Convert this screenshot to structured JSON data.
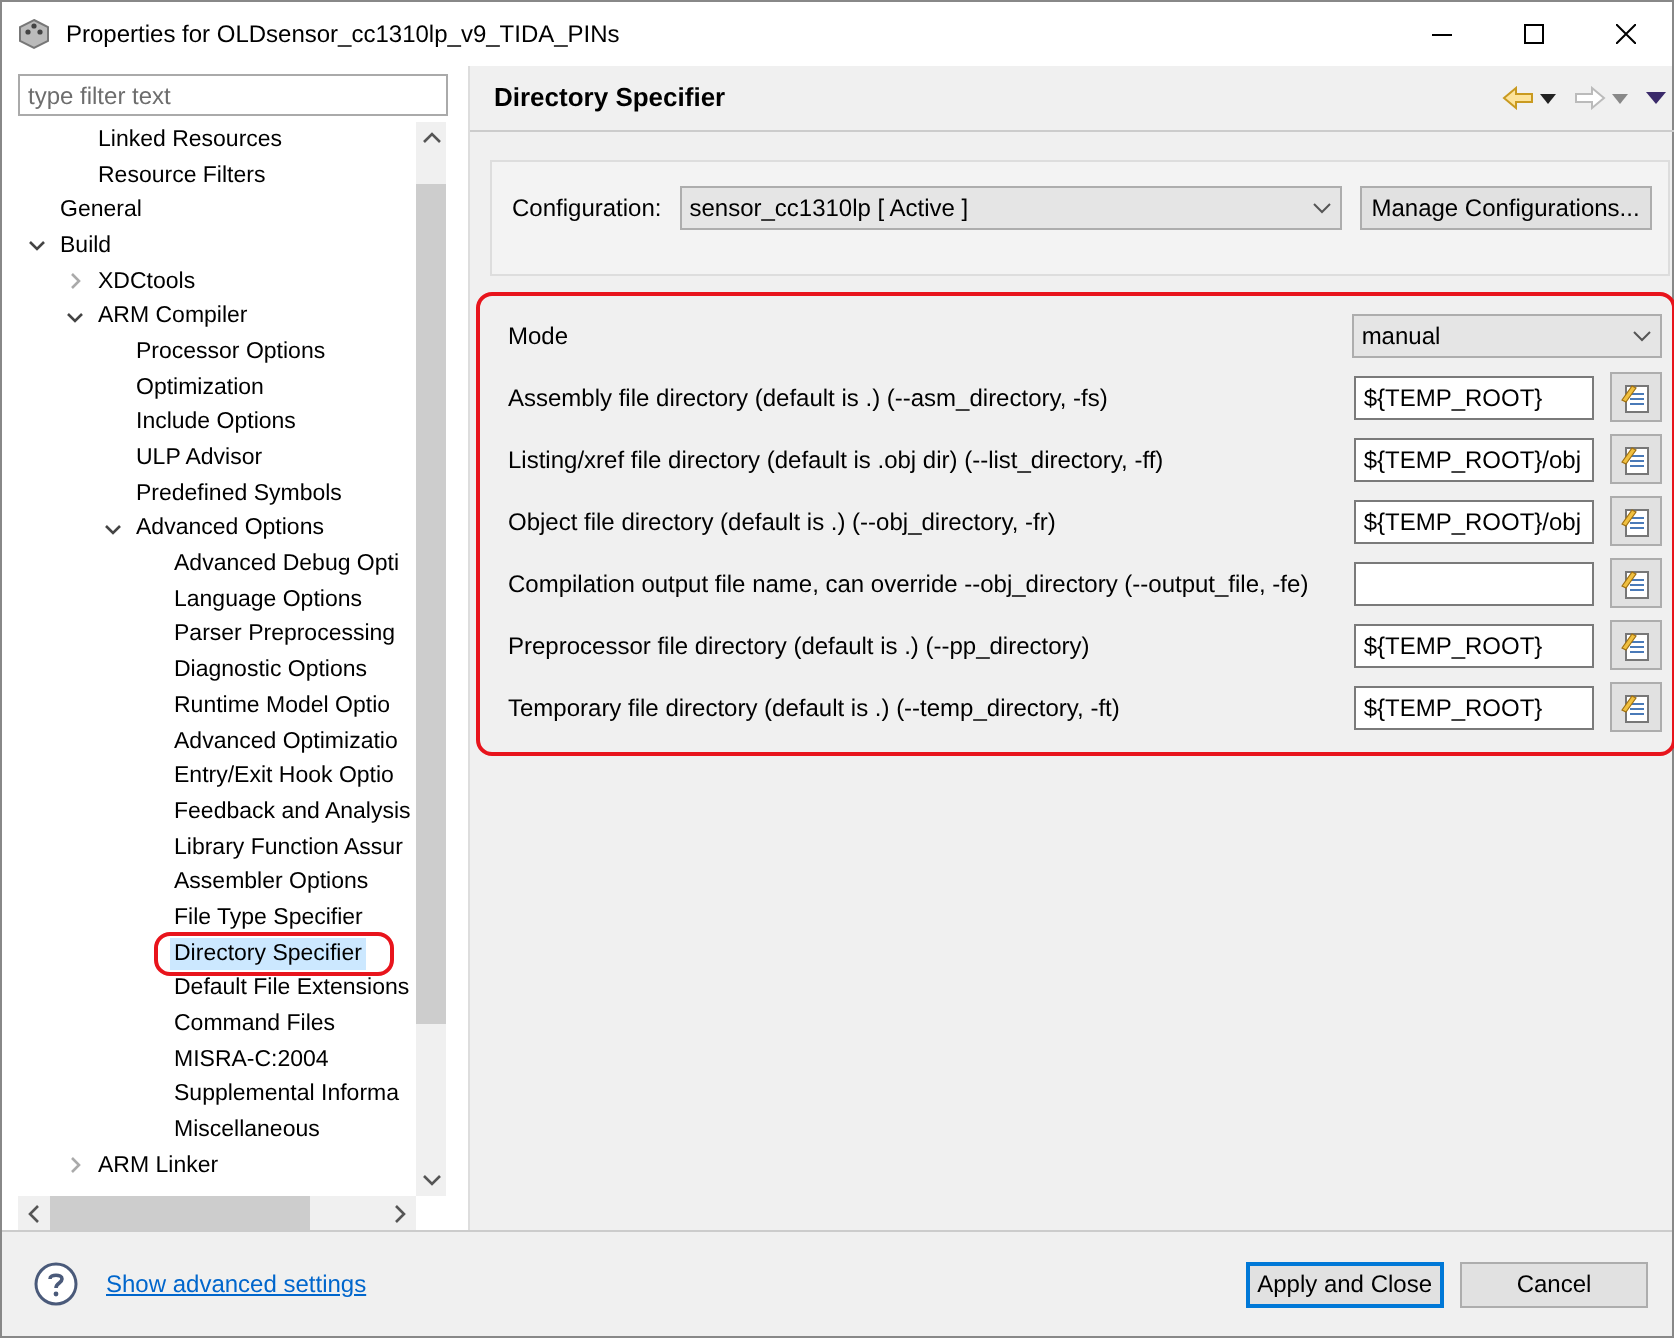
{
  "window": {
    "title": "Properties for OLDsensor_cc1310lp_v9_TIDA_PINs"
  },
  "filter": {
    "placeholder": "type filter text"
  },
  "tree": [
    {
      "children": [
        {
          "label": "Linked Resources",
          "selected": false
        },
        {
          "label": "Resource Filters",
          "selected": false
        }
      ]
    },
    {
      "label": "General",
      "selected": false
    },
    {
      "label": "Build",
      "selected": false,
      "expanded": true,
      "children": [
        {
          "label": "XDCtools",
          "selected": false,
          "expanded": false
        },
        {
          "label": "ARM Compiler",
          "selected": false,
          "expanded": true,
          "children": [
            {
              "label": "Processor Options",
              "selected": false
            },
            {
              "label": "Optimization",
              "selected": false
            },
            {
              "label": "Include Options",
              "selected": false
            },
            {
              "label": "ULP Advisor",
              "selected": false
            },
            {
              "label": "Predefined Symbols",
              "selected": false
            },
            {
              "label": "Advanced Options",
              "selected": false,
              "expanded": true,
              "children": [
                {
                  "label": "Advanced Debug Opti",
                  "selected": false
                },
                {
                  "label": "Language Options",
                  "selected": false
                },
                {
                  "label": "Parser Preprocessing",
                  "selected": false
                },
                {
                  "label": "Diagnostic Options",
                  "selected": false
                },
                {
                  "label": "Runtime Model Optio",
                  "selected": false
                },
                {
                  "label": "Advanced Optimizatio",
                  "selected": false
                },
                {
                  "label": "Entry/Exit Hook Optio",
                  "selected": false
                },
                {
                  "label": "Feedback and Analysis",
                  "selected": false
                },
                {
                  "label": "Library Function Assur",
                  "selected": false
                },
                {
                  "label": "Assembler Options",
                  "selected": false
                },
                {
                  "label": "File Type Specifier",
                  "selected": false
                },
                {
                  "label": "Directory Specifier",
                  "selected": true,
                  "annotated": true
                },
                {
                  "label": "Default File Extensions",
                  "selected": false
                },
                {
                  "label": "Command Files",
                  "selected": false
                },
                {
                  "label": "MISRA-C:2004",
                  "selected": false
                },
                {
                  "label": "Supplemental Informa",
                  "selected": false
                },
                {
                  "label": "Miscellaneous",
                  "selected": false
                }
              ]
            }
          ]
        },
        {
          "label": "ARM Linker",
          "selected": false,
          "expanded": false
        }
      ]
    }
  ],
  "page": {
    "title": "Directory Specifier"
  },
  "configuration": {
    "label": "Configuration:",
    "value": "sensor_cc1310lp  [ Active ]",
    "button": "Manage Configurations..."
  },
  "settings": {
    "annotated": true,
    "rows": [
      {
        "kind": "select",
        "label": "Mode",
        "value": "manual"
      },
      {
        "kind": "path",
        "label": "Assembly file directory (default is .) (--asm_directory, -fs)",
        "value": "${TEMP_ROOT}"
      },
      {
        "kind": "path",
        "label": "Listing/xref file directory (default is .obj dir) (--list_directory, -ff)",
        "value": "${TEMP_ROOT}/obj"
      },
      {
        "kind": "path",
        "label": "Object file directory (default is .) (--obj_directory, -fr)",
        "value": "${TEMP_ROOT}/obj"
      },
      {
        "kind": "path",
        "label": "Compilation output file name, can override --obj_directory (--output_file, -fe)"
      },
      {
        "kind": "path",
        "label": "Preprocessor file directory (default is .) (--pp_directory)",
        "value": "${TEMP_ROOT}"
      },
      {
        "kind": "path",
        "label": "Temporary file directory (default is .) (--temp_directory, -ft)",
        "value": "${TEMP_ROOT}"
      }
    ]
  },
  "footer": {
    "link": "Show advanced settings",
    "buttons": [
      {
        "label": "Apply and Close",
        "default": true
      },
      {
        "label": "Cancel",
        "default": false
      }
    ]
  }
}
